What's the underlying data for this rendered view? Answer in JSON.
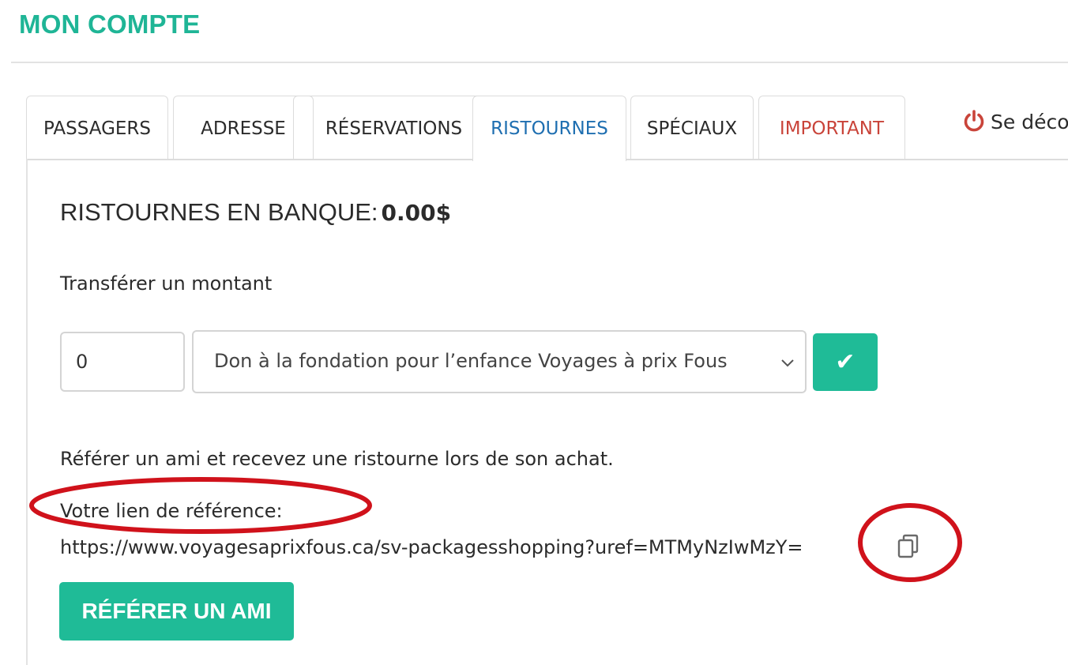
{
  "page": {
    "title": "MON COMPTE"
  },
  "tabs": [
    {
      "label": "PASSAGERS"
    },
    {
      "label": "ADRESSE"
    },
    {
      "label": "RÉSERVATIONS"
    },
    {
      "label": "RISTOURNES",
      "active": true
    },
    {
      "label": "SPÉCIAUX"
    },
    {
      "label": "IMPORTANT"
    }
  ],
  "logout": {
    "label": "Se déco",
    "icon": "power-icon",
    "icon_color": "#c9443a"
  },
  "bank": {
    "label": "RISTOURNES EN BANQUE:",
    "amount": "0.00$"
  },
  "transfer": {
    "label": "Transférer un montant",
    "amount_value": "0",
    "selected_option": "Don à la fondation pour l’enfance Voyages à prix Fous",
    "submit_symbol": "✔"
  },
  "referral": {
    "intro": "Référer un ami et recevez une ristourne lors de son achat.",
    "link_label": "Votre lien de référence:",
    "link": "https://www.voyagesaprixfous.ca/sv-packagesshopping?uref=MTMyNzIwMzY=",
    "copy_icon": "copy-icon",
    "button_label": "RÉFÉRER UN AMI"
  },
  "colors": {
    "accent": "#1fbb97",
    "title": "#1fb596",
    "active_tab": "#1f6fb1",
    "important_tab": "#c9443a",
    "annotation": "#d0121b"
  }
}
